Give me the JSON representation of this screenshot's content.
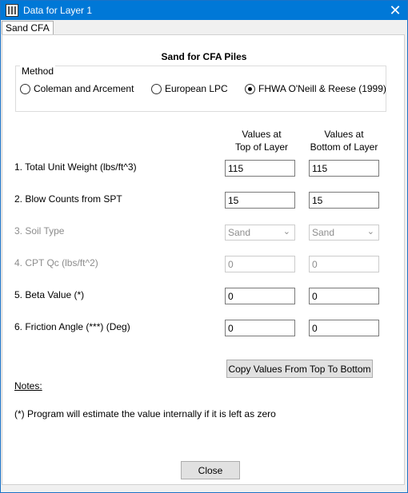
{
  "window": {
    "title": "Data for Layer 1",
    "close_glyph": "✕"
  },
  "tabs": [
    {
      "label": "Sand CFA"
    }
  ],
  "heading": "Sand for CFA Piles",
  "method": {
    "legend": "Method",
    "options": [
      {
        "label": "Coleman and Arcement",
        "selected": false
      },
      {
        "label": "European LPC",
        "selected": false
      },
      {
        "label": "FHWA O'Neill & Reese (1999)",
        "selected": true
      }
    ]
  },
  "columns": {
    "top": {
      "line1": "Values at",
      "line2": "Top of Layer"
    },
    "bottom": {
      "line1": "Values at",
      "line2": "Bottom of Layer"
    }
  },
  "rows": [
    {
      "label": "1. Total Unit Weight (lbs/ft^3)",
      "top": "115",
      "bottom": "115"
    },
    {
      "label": "2. Blow Counts from SPT",
      "top": "15",
      "bottom": "15"
    },
    {
      "label": "3. Soil Type",
      "top": "Sand",
      "bottom": "Sand"
    },
    {
      "label": "4. CPT Qc (lbs/ft^2)",
      "top": "0",
      "bottom": "0"
    },
    {
      "label": "5. Beta Value (*)",
      "top": "0",
      "bottom": "0"
    },
    {
      "label": "6. Friction Angle (***) (Deg)",
      "top": "0",
      "bottom": "0"
    }
  ],
  "copy_button": "Copy Values From Top To Bottom",
  "notes": {
    "heading": "Notes:",
    "items": [
      "(*)  Program will estimate the value internally if it is left as zero"
    ]
  },
  "close_button": "Close",
  "icons": {
    "app": "app-icon",
    "chevron": "chevron-down-icon",
    "close": "close-icon"
  },
  "colors": {
    "titlebar": "#0078d7",
    "disabled_text": "#8d8d8d"
  }
}
